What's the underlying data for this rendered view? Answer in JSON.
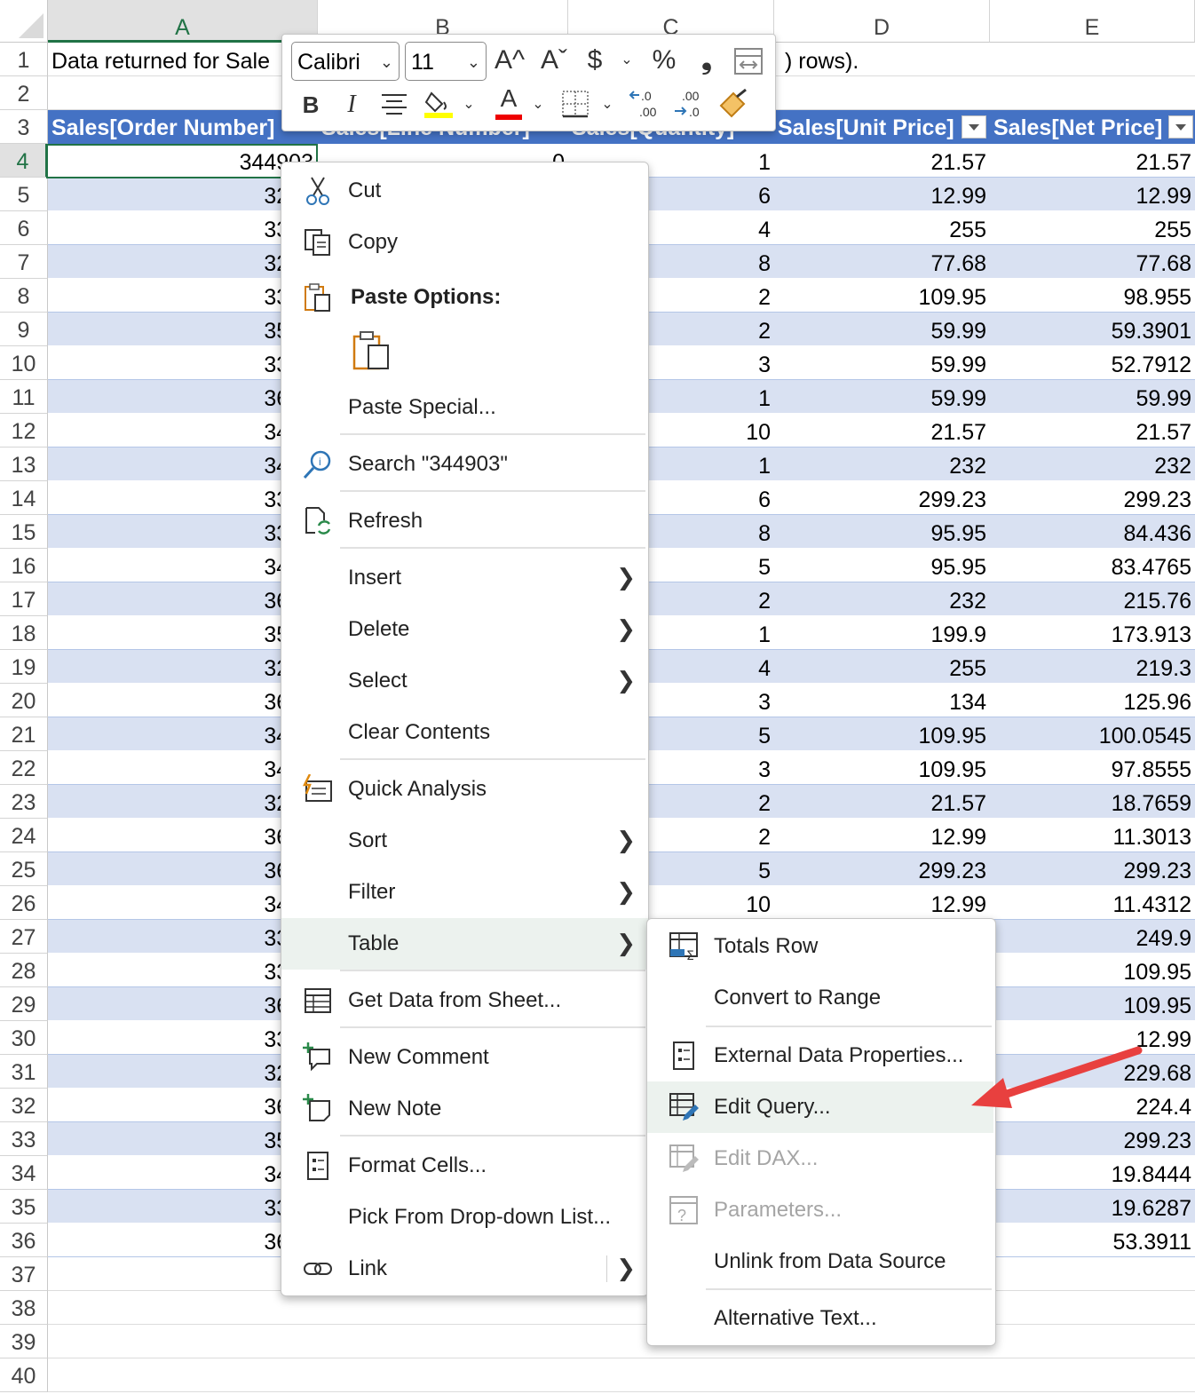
{
  "columns": [
    "A",
    "B",
    "C",
    "D",
    "E"
  ],
  "cell_A1": "Data returned for Sale",
  "cell_C1_tail": ") rows).",
  "table_headers": [
    "Sales[Order Number]",
    "Sales[Line Number]",
    "Sales[Quantity]",
    "Sales[Unit Price]",
    "Sales[Net Price]"
  ],
  "rows": [
    {
      "n": "4",
      "a": "344903",
      "b": "0",
      "c": "1",
      "d": "21.57",
      "e": "21.57"
    },
    {
      "n": "5",
      "a": "3289",
      "c": "6",
      "d": "12.99",
      "e": "12.99"
    },
    {
      "n": "6",
      "a": "3352",
      "c": "4",
      "d": "255",
      "e": "255"
    },
    {
      "n": "7",
      "a": "3296",
      "c": "8",
      "d": "77.68",
      "e": "77.68"
    },
    {
      "n": "8",
      "a": "3302",
      "c": "2",
      "d": "109.95",
      "e": "98.955"
    },
    {
      "n": "9",
      "a": "3530",
      "c": "2",
      "d": "59.99",
      "e": "59.3901"
    },
    {
      "n": "10",
      "a": "3306",
      "c": "3",
      "d": "59.99",
      "e": "52.7912"
    },
    {
      "n": "11",
      "a": "3626",
      "c": "1",
      "d": "59.99",
      "e": "59.99"
    },
    {
      "n": "12",
      "a": "3408",
      "c": "10",
      "d": "21.57",
      "e": "21.57"
    },
    {
      "n": "13",
      "a": "3430",
      "c": "1",
      "d": "232",
      "e": "232"
    },
    {
      "n": "14",
      "a": "3342",
      "c": "6",
      "d": "299.23",
      "e": "299.23"
    },
    {
      "n": "15",
      "a": "3358",
      "c": "8",
      "d": "95.95",
      "e": "84.436"
    },
    {
      "n": "16",
      "a": "3452",
      "c": "5",
      "d": "95.95",
      "e": "83.4765"
    },
    {
      "n": "17",
      "a": "3651",
      "c": "2",
      "d": "232",
      "e": "215.76"
    },
    {
      "n": "18",
      "a": "3577",
      "c": "1",
      "d": "199.9",
      "e": "173.913"
    },
    {
      "n": "19",
      "a": "3296",
      "c": "4",
      "d": "255",
      "e": "219.3"
    },
    {
      "n": "20",
      "a": "3652",
      "c": "3",
      "d": "134",
      "e": "125.96"
    },
    {
      "n": "21",
      "a": "3458",
      "c": "5",
      "d": "109.95",
      "e": "100.0545"
    },
    {
      "n": "22",
      "a": "3408",
      "c": "3",
      "d": "109.95",
      "e": "97.8555"
    },
    {
      "n": "23",
      "a": "3290",
      "c": "2",
      "d": "21.57",
      "e": "18.7659"
    },
    {
      "n": "24",
      "a": "3642",
      "c": "2",
      "d": "12.99",
      "e": "11.3013"
    },
    {
      "n": "25",
      "a": "3651",
      "c": "5",
      "d": "299.23",
      "e": "299.23"
    },
    {
      "n": "26",
      "a": "3494",
      "c": "10",
      "d": "12.99",
      "e": "11.4312"
    },
    {
      "n": "27",
      "a": "3353",
      "c": "",
      "d": "",
      "e": "249.9"
    },
    {
      "n": "28",
      "a": "3306",
      "c": "",
      "d": "",
      "e": "109.95"
    },
    {
      "n": "29",
      "a": "3644",
      "c": "",
      "d": "",
      "e": "109.95"
    },
    {
      "n": "30",
      "a": "3337",
      "c": "",
      "d": "",
      "e": "12.99"
    },
    {
      "n": "31",
      "a": "3299",
      "c": "",
      "d": "",
      "e": "229.68"
    },
    {
      "n": "32",
      "a": "3619",
      "c": "",
      "d": "",
      "e": "224.4"
    },
    {
      "n": "33",
      "a": "3581",
      "c": "",
      "d": "",
      "e": "299.23"
    },
    {
      "n": "34",
      "a": "3470",
      "c": "",
      "d": "",
      "e": "19.8444"
    },
    {
      "n": "35",
      "a": "3362",
      "c": "",
      "d": "",
      "e": "19.6287"
    },
    {
      "n": "36",
      "a": "3638",
      "c": "",
      "d": "",
      "e": "53.3911"
    }
  ],
  "row_numbers_top": [
    "1",
    "2",
    "3"
  ],
  "row_numbers_bottom": [
    "37",
    "38",
    "39",
    "40"
  ],
  "mini_toolbar": {
    "font": "Calibri",
    "size": "11",
    "grow_font": "A^",
    "shrink_font": "Aˇ",
    "currency": "$",
    "percent": "%",
    "comma": "❟",
    "bold": "B",
    "italic": "I",
    "font_color_glyph": "A",
    "inc_decimal": ".0\n.00",
    "dec_decimal": ".00\n.0"
  },
  "context_menu": {
    "cut": "Cut",
    "copy": "Copy",
    "paste_options": "Paste Options:",
    "paste_special": "Paste Special...",
    "search": "Search \"344903\"",
    "refresh": "Refresh",
    "insert": "Insert",
    "delete": "Delete",
    "select": "Select",
    "clear_contents": "Clear Contents",
    "quick_analysis": "Quick Analysis",
    "sort": "Sort",
    "filter": "Filter",
    "table": "Table",
    "get_data": "Get Data from Sheet...",
    "new_comment": "New Comment",
    "new_note": "New Note",
    "format_cells": "Format Cells...",
    "pick_list": "Pick From Drop-down List...",
    "link": "Link"
  },
  "table_submenu": {
    "totals_row": "Totals Row",
    "convert_range": "Convert to Range",
    "external_props": "External Data Properties...",
    "edit_query": "Edit Query...",
    "edit_dax": "Edit DAX...",
    "parameters": "Parameters...",
    "unlink": "Unlink from Data Source",
    "alt_text": "Alternative Text..."
  },
  "colors": {
    "table_header": "#4472c4",
    "band": "#d9e1f2",
    "accent_green": "#217346",
    "annotation_arrow": "#e8403f"
  }
}
